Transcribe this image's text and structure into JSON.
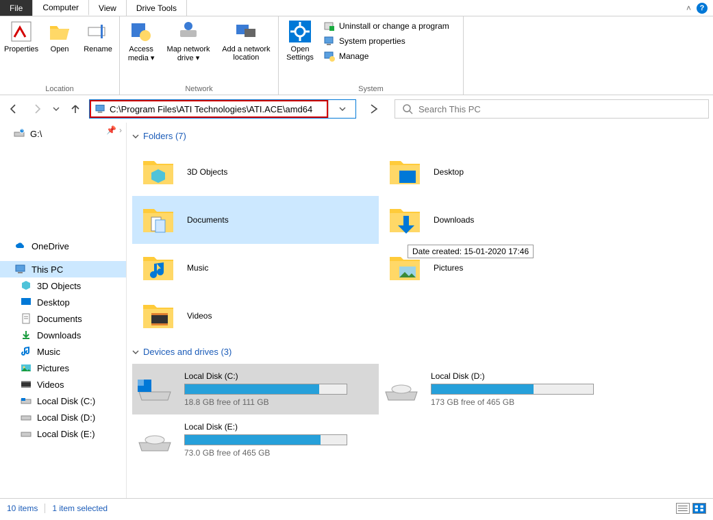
{
  "tabs": {
    "file": "File",
    "computer": "Computer",
    "view": "View",
    "drivetools": "Drive Tools"
  },
  "ribbon": {
    "properties": "Properties",
    "open": "Open",
    "rename": "Rename",
    "access_media": "Access media ▾",
    "map_drive": "Map network drive ▾",
    "add_location": "Add a network location",
    "open_settings": "Open Settings",
    "uninstall": "Uninstall or change a program",
    "sys_props": "System properties",
    "manage": "Manage",
    "grp_location": "Location",
    "grp_network": "Network",
    "grp_system": "System"
  },
  "nav": {
    "address": "C:\\Program Files\\ATI Technologies\\ATI.ACE\\amd64"
  },
  "search": {
    "placeholder": "Search This PC"
  },
  "sidebar": {
    "g": "G:\\",
    "onedrive": "OneDrive",
    "thispc": "This PC",
    "threeD": "3D Objects",
    "desktop": "Desktop",
    "documents": "Documents",
    "downloads": "Downloads",
    "music": "Music",
    "pictures": "Pictures",
    "videos": "Videos",
    "diskC": "Local Disk (C:)",
    "diskD": "Local Disk (D:)",
    "diskE": "Local Disk (E:)"
  },
  "groups": {
    "folders": "Folders (7)",
    "drives": "Devices and drives (3)"
  },
  "folders": {
    "threeD": "3D Objects",
    "desktop": "Desktop",
    "documents": "Documents",
    "downloads": "Downloads",
    "music": "Music",
    "pictures": "Pictures",
    "videos": "Videos"
  },
  "tooltip": "Date created: 15-01-2020 17:46",
  "drives": {
    "c": {
      "name": "Local Disk (C:)",
      "free": "18.8 GB free of 111 GB",
      "pct": 83
    },
    "d": {
      "name": "Local Disk (D:)",
      "free": "173 GB free of 465 GB",
      "pct": 63
    },
    "e": {
      "name": "Local Disk (E:)",
      "free": "73.0 GB free of 465 GB",
      "pct": 84
    }
  },
  "status": {
    "items": "10 items",
    "selected": "1 item selected"
  }
}
